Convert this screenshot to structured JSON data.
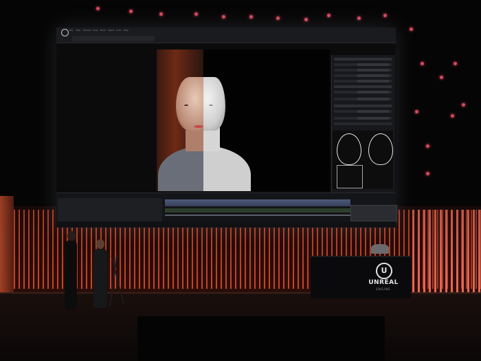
{
  "screen": {
    "menu": [
      "File",
      "Edit",
      "Window",
      "Tools",
      "Build",
      "Select",
      "Actor",
      "Help"
    ],
    "tab": "",
    "timeline_label": "",
    "details_title": "",
    "notification": ""
  },
  "podium": {
    "logo_letter": "U",
    "brand": "UNREAL",
    "sub": "ENGINE"
  },
  "colors": {
    "stage_red": "#e65032",
    "ceiling_dot": "#d4495a",
    "timeline_track": "#4e5a78"
  }
}
